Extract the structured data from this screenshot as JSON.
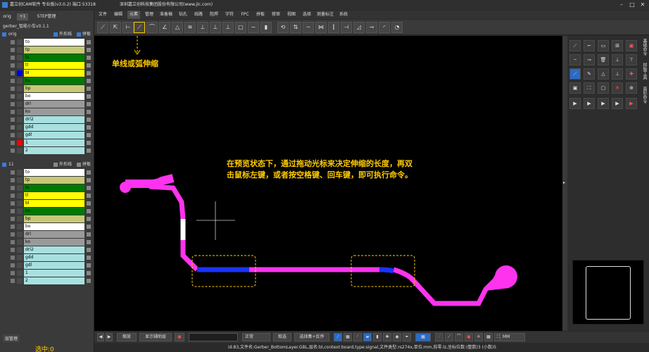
{
  "title_bar": {
    "app_title": "嘉立创CAM软件 专业版(v3.0.2) 端口:53318",
    "company": "深圳嘉立创科技集团股份有限公司(www.jlc.com)"
  },
  "menu": [
    "文件",
    "编辑",
    "元素",
    "管理",
    "准备稿",
    "钻孔",
    "线路",
    "阻焊",
    "字符",
    "FPC",
    "拼板",
    "修审",
    "视图",
    "选择",
    "测量标注",
    "系统"
  ],
  "active_menu": "元素",
  "left_panel": {
    "tabs": [
      "orig",
      "+1",
      "STEP管理"
    ],
    "job_name": "gerber_智能小车v0.1.1",
    "group1": {
      "name": "orig",
      "outline_label": "外形线",
      "panel_label": "拼板"
    },
    "group2": {
      "name": "11",
      "outline_label": "外形线",
      "panel_label": "拼板"
    },
    "layers1": [
      {
        "name": "to",
        "color": "#ffffff",
        "swatch": ""
      },
      {
        "name": "tp",
        "color": "#c8c878",
        "swatch": ""
      },
      {
        "name": "ts",
        "color": "#007a00",
        "swatch": ""
      },
      {
        "name": "tl",
        "color": "#ffff00",
        "swatch": ""
      },
      {
        "name": "bl",
        "color": "#ffff00",
        "swatch": "#0000ff"
      },
      {
        "name": "bs",
        "color": "#007a00",
        "swatch": ""
      },
      {
        "name": "bp",
        "color": "#c8c878",
        "swatch": ""
      },
      {
        "name": "bo",
        "color": "#ffffff",
        "swatch": ""
      },
      {
        "name": "drl",
        "color": "#9a9a9a",
        "swatch": ""
      },
      {
        "name": "ko",
        "color": "#9a9a9a",
        "swatch": ""
      },
      {
        "name": "drl2",
        "color": "#a8e0e0",
        "swatch": ""
      },
      {
        "name": "gdd",
        "color": "#a8e0e0",
        "swatch": ""
      },
      {
        "name": "gdl",
        "color": "#a8e0e0",
        "swatch": ""
      },
      {
        "name": "1",
        "color": "#a8e0e0",
        "swatch": "#ff0000"
      },
      {
        "name": "2",
        "color": "#a8e0e0",
        "swatch": ""
      }
    ],
    "layers2": [
      {
        "name": "to",
        "color": "#ffffff"
      },
      {
        "name": "tp",
        "color": "#c8c878"
      },
      {
        "name": "ts",
        "color": "#007a00"
      },
      {
        "name": "tl",
        "color": "#ffff00"
      },
      {
        "name": "bl",
        "color": "#ffff00"
      },
      {
        "name": "bs",
        "color": "#007a00"
      },
      {
        "name": "bp",
        "color": "#c8c878"
      },
      {
        "name": "bo",
        "color": "#ffffff"
      },
      {
        "name": "drl",
        "color": "#9a9a9a"
      },
      {
        "name": "ko",
        "color": "#9a9a9a"
      },
      {
        "name": "drl2",
        "color": "#a8e0e0"
      },
      {
        "name": "gdd",
        "color": "#a8e0e0"
      },
      {
        "name": "gdl",
        "color": "#a8e0e0"
      },
      {
        "name": "1",
        "color": "#a8e0e0"
      },
      {
        "name": "2",
        "color": "#a8e0e0"
      }
    ],
    "bottom_tab": "层管理",
    "selected_label": "选中:0"
  },
  "canvas": {
    "tool_annotation": "单线或弧伸缩",
    "instruction_line1": "在预览状态下，通过拖动光标来决定伸缩的长度，再双",
    "instruction_line2": "击鼠标左键，或者按空格键、回车键，即可执行命令。"
  },
  "right_panel": {
    "side_labels": [
      "基础命令",
      "拼板工具",
      "高阶命令"
    ]
  },
  "bottom_bar": {
    "zoom_label": "缩放",
    "display_label": "显示辅助层",
    "mode_label": "正常",
    "select_label": "取选",
    "filter_label": "选择集+反序",
    "unit": "MM"
  },
  "status_bar": {
    "text": "id:83,文件名:Gerber_BottomLayer.GBL,层名:bl,context:board,type:signal,文件类型:rs274x,单位:mm,前零:lz,坐标位数:(整数)3 (小数)5"
  },
  "colors": {
    "trace": "#ff33ee",
    "selected_segment": "#0000ff",
    "annotation": "#ffcc00"
  }
}
